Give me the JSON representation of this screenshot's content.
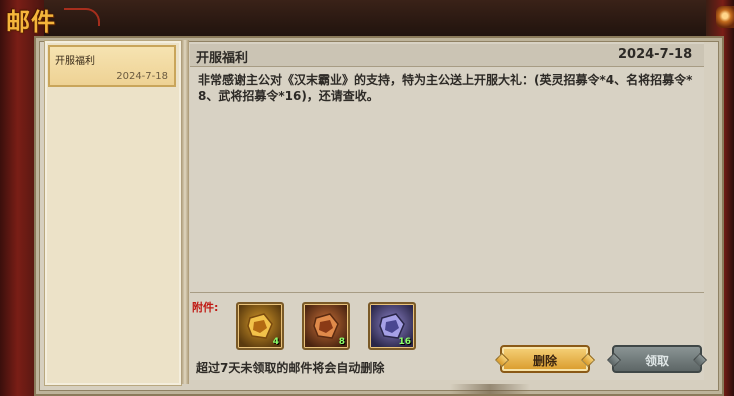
{
  "window": {
    "title": "邮件"
  },
  "mail_list": [
    {
      "title": "开服福利",
      "date": "2024-7-18"
    }
  ],
  "mail": {
    "title": "开服福利",
    "date": "2024-7-18",
    "body": "非常感谢主公对《汉末霸业》的支持，特为主公送上开服大礼：(英灵招募令*4、名将招募令*8、武将招募令*16)，还请查收。"
  },
  "attachments": {
    "label": "附件:",
    "items": [
      {
        "icon": "gold-recruit-token-icon",
        "count": "4"
      },
      {
        "icon": "bronze-recruit-token-icon",
        "count": "8"
      },
      {
        "icon": "violet-recruit-token-icon",
        "count": "16"
      }
    ]
  },
  "footer": {
    "notice": "超过7天未领取的邮件将会自动删除",
    "delete_label": "删除",
    "claim_label": "领取"
  },
  "colors": {
    "title_gold": "#f5b53b",
    "delete_button": "#e8b54c",
    "claim_button": "#6f7979",
    "count_green": "#8cff6a",
    "attach_label_red": "#c01a14"
  }
}
